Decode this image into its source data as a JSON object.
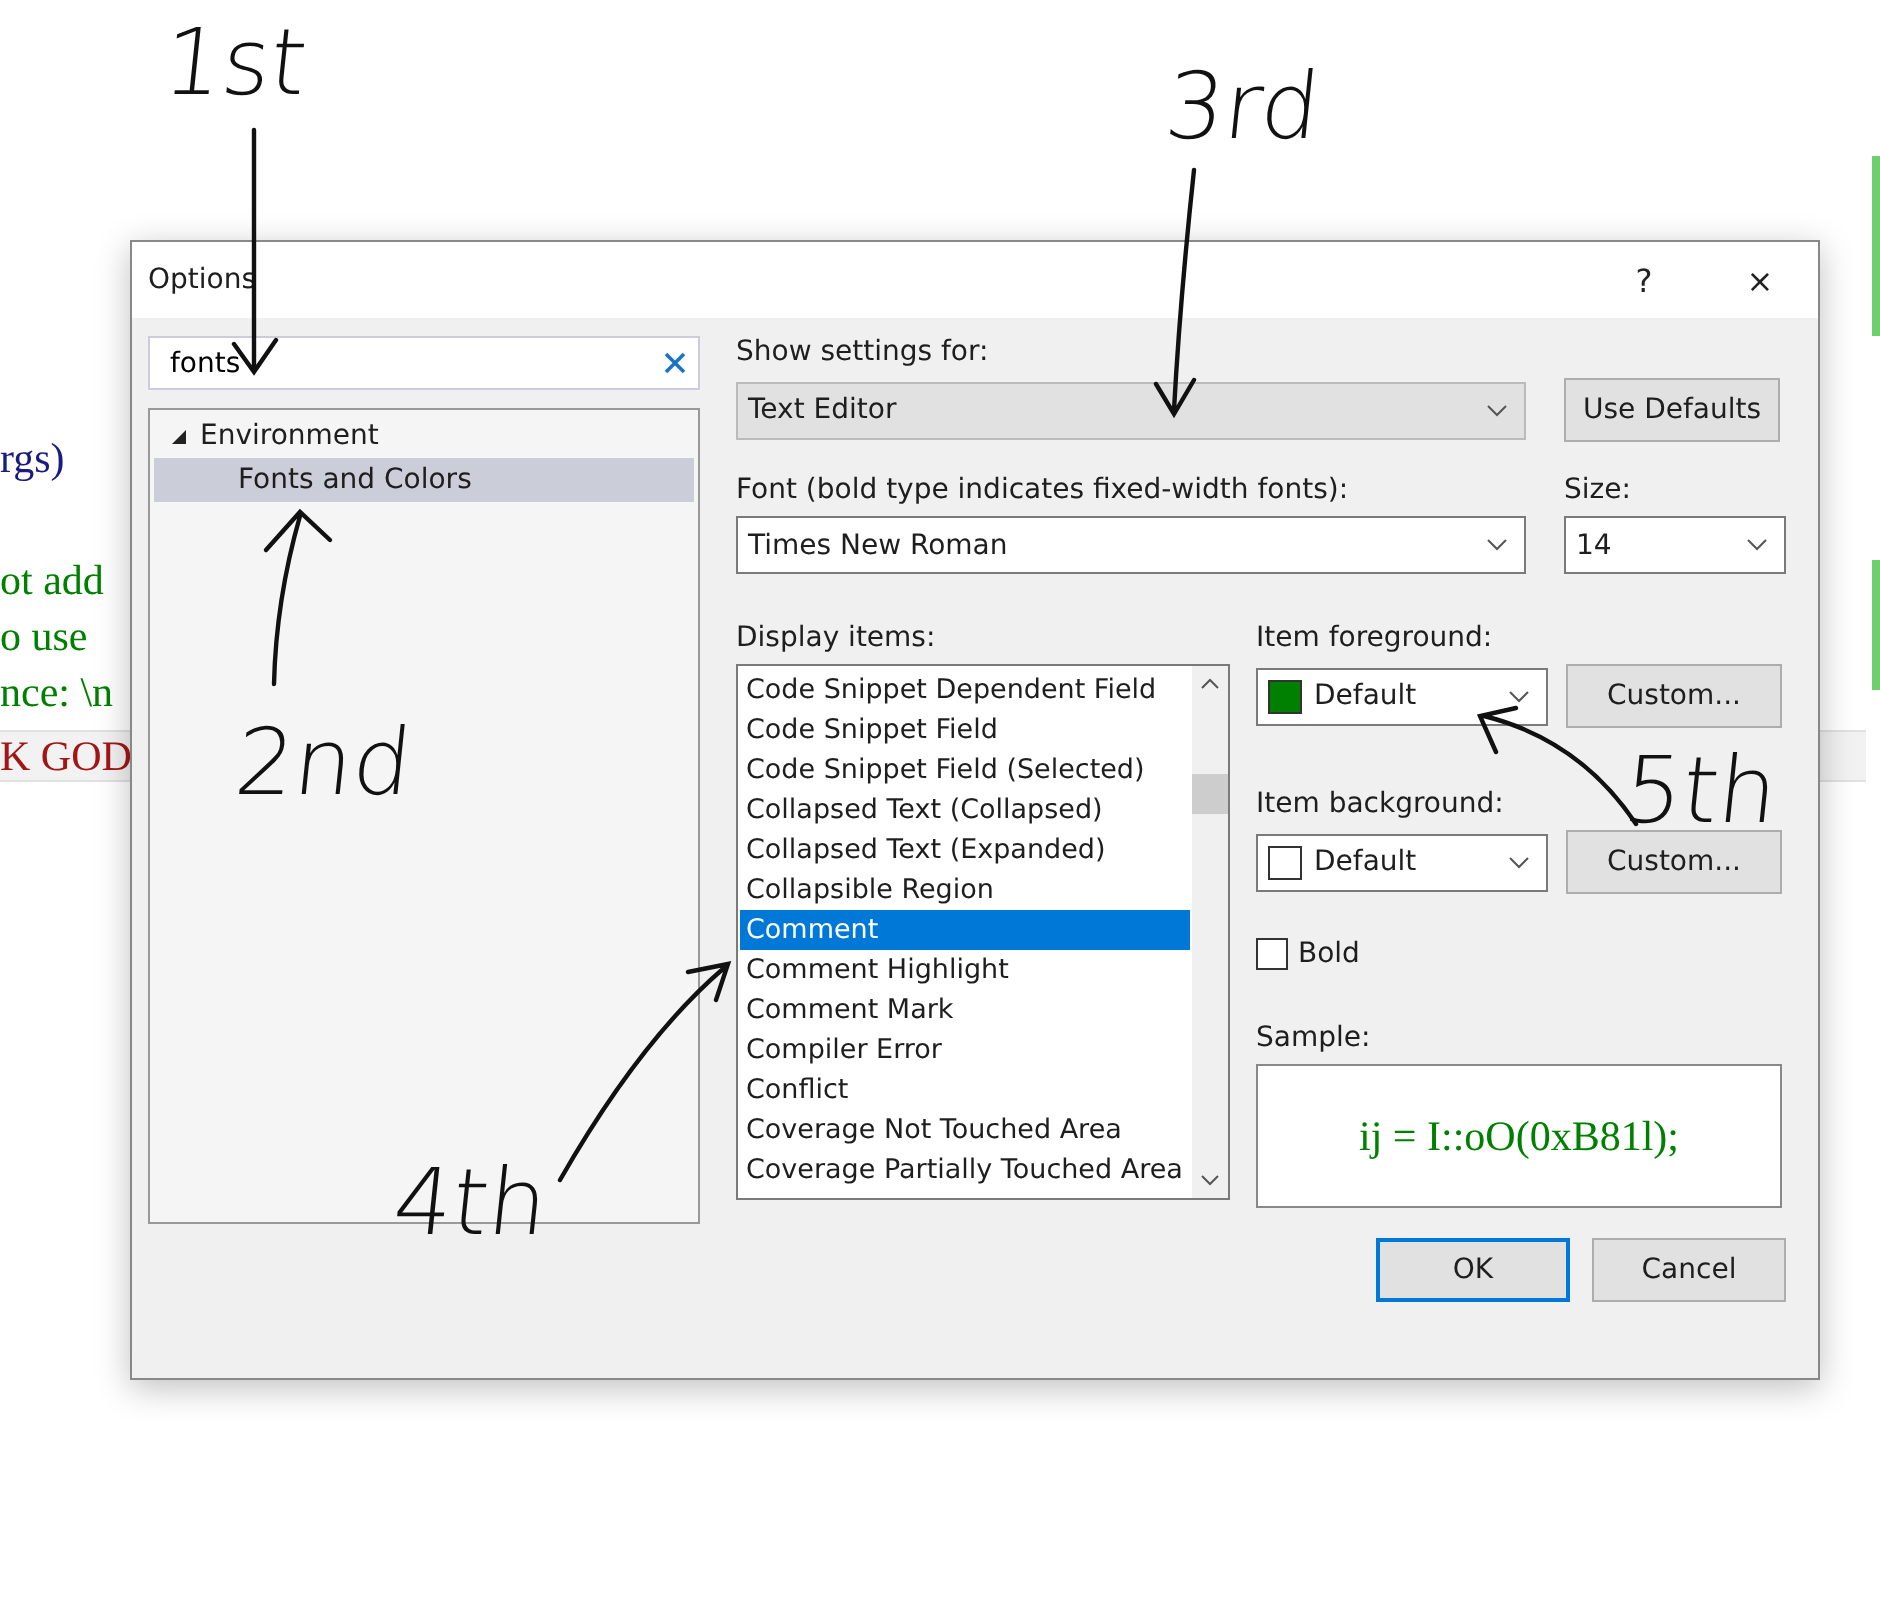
{
  "background_code": [
    {
      "text": "rgs)",
      "color": "#1a1a80",
      "highlighted": false
    },
    {
      "text": "ot add",
      "color": "#008000",
      "highlighted": false
    },
    {
      "text": "o use",
      "color": "#008000",
      "highlighted": false
    },
    {
      "text": "nce: \\n",
      "color": "#008000",
      "highlighted": false
    },
    {
      "text": "K GOD",
      "color": "#a31515",
      "highlighted": true
    }
  ],
  "dialog": {
    "title": "Options",
    "help": "?",
    "close": "×",
    "search": {
      "value": "fonts"
    },
    "tree": [
      {
        "label": "Environment",
        "expanded": true,
        "selected": false,
        "children": [
          {
            "label": "Fonts and Colors",
            "selected": true
          }
        ]
      }
    ],
    "show_settings_for": {
      "label": "Show settings for:",
      "value": "Text Editor"
    },
    "use_defaults": "Use Defaults",
    "font": {
      "label": "Font (bold type indicates fixed-width fonts):",
      "value": "Times New Roman"
    },
    "size": {
      "label": "Size:",
      "value": "14"
    },
    "display_items": {
      "label": "Display items:",
      "items": [
        {
          "label": "Code Snippet Dependent Field",
          "selected": false
        },
        {
          "label": "Code Snippet Field",
          "selected": false
        },
        {
          "label": "Code Snippet Field (Selected)",
          "selected": false
        },
        {
          "label": "Collapsed Text (Collapsed)",
          "selected": false
        },
        {
          "label": "Collapsed Text (Expanded)",
          "selected": false
        },
        {
          "label": "Collapsible Region",
          "selected": false
        },
        {
          "label": "Comment",
          "selected": true
        },
        {
          "label": "Comment Highlight",
          "selected": false
        },
        {
          "label": "Comment Mark",
          "selected": false
        },
        {
          "label": "Compiler Error",
          "selected": false
        },
        {
          "label": "Conflict",
          "selected": false
        },
        {
          "label": "Coverage Not Touched Area",
          "selected": false
        },
        {
          "label": "Coverage Partially Touched Area",
          "selected": false
        }
      ]
    },
    "item_foreground": {
      "label": "Item foreground:",
      "value": "Default",
      "color": "#008000",
      "custom": "Custom..."
    },
    "item_background": {
      "label": "Item background:",
      "value": "Default",
      "color": "#ffffff",
      "custom": "Custom..."
    },
    "bold": {
      "label": "Bold",
      "checked": false
    },
    "sample": {
      "label": "Sample:",
      "text": "ij = I::oO(0xB81l);"
    },
    "buttons": [
      {
        "label": "OK",
        "default": true
      },
      {
        "label": "Cancel",
        "default": false
      }
    ]
  },
  "annotations": [
    {
      "text": "1st"
    },
    {
      "text": "2nd"
    },
    {
      "text": "3rd"
    },
    {
      "text": "4th"
    },
    {
      "text": "5th"
    }
  ]
}
